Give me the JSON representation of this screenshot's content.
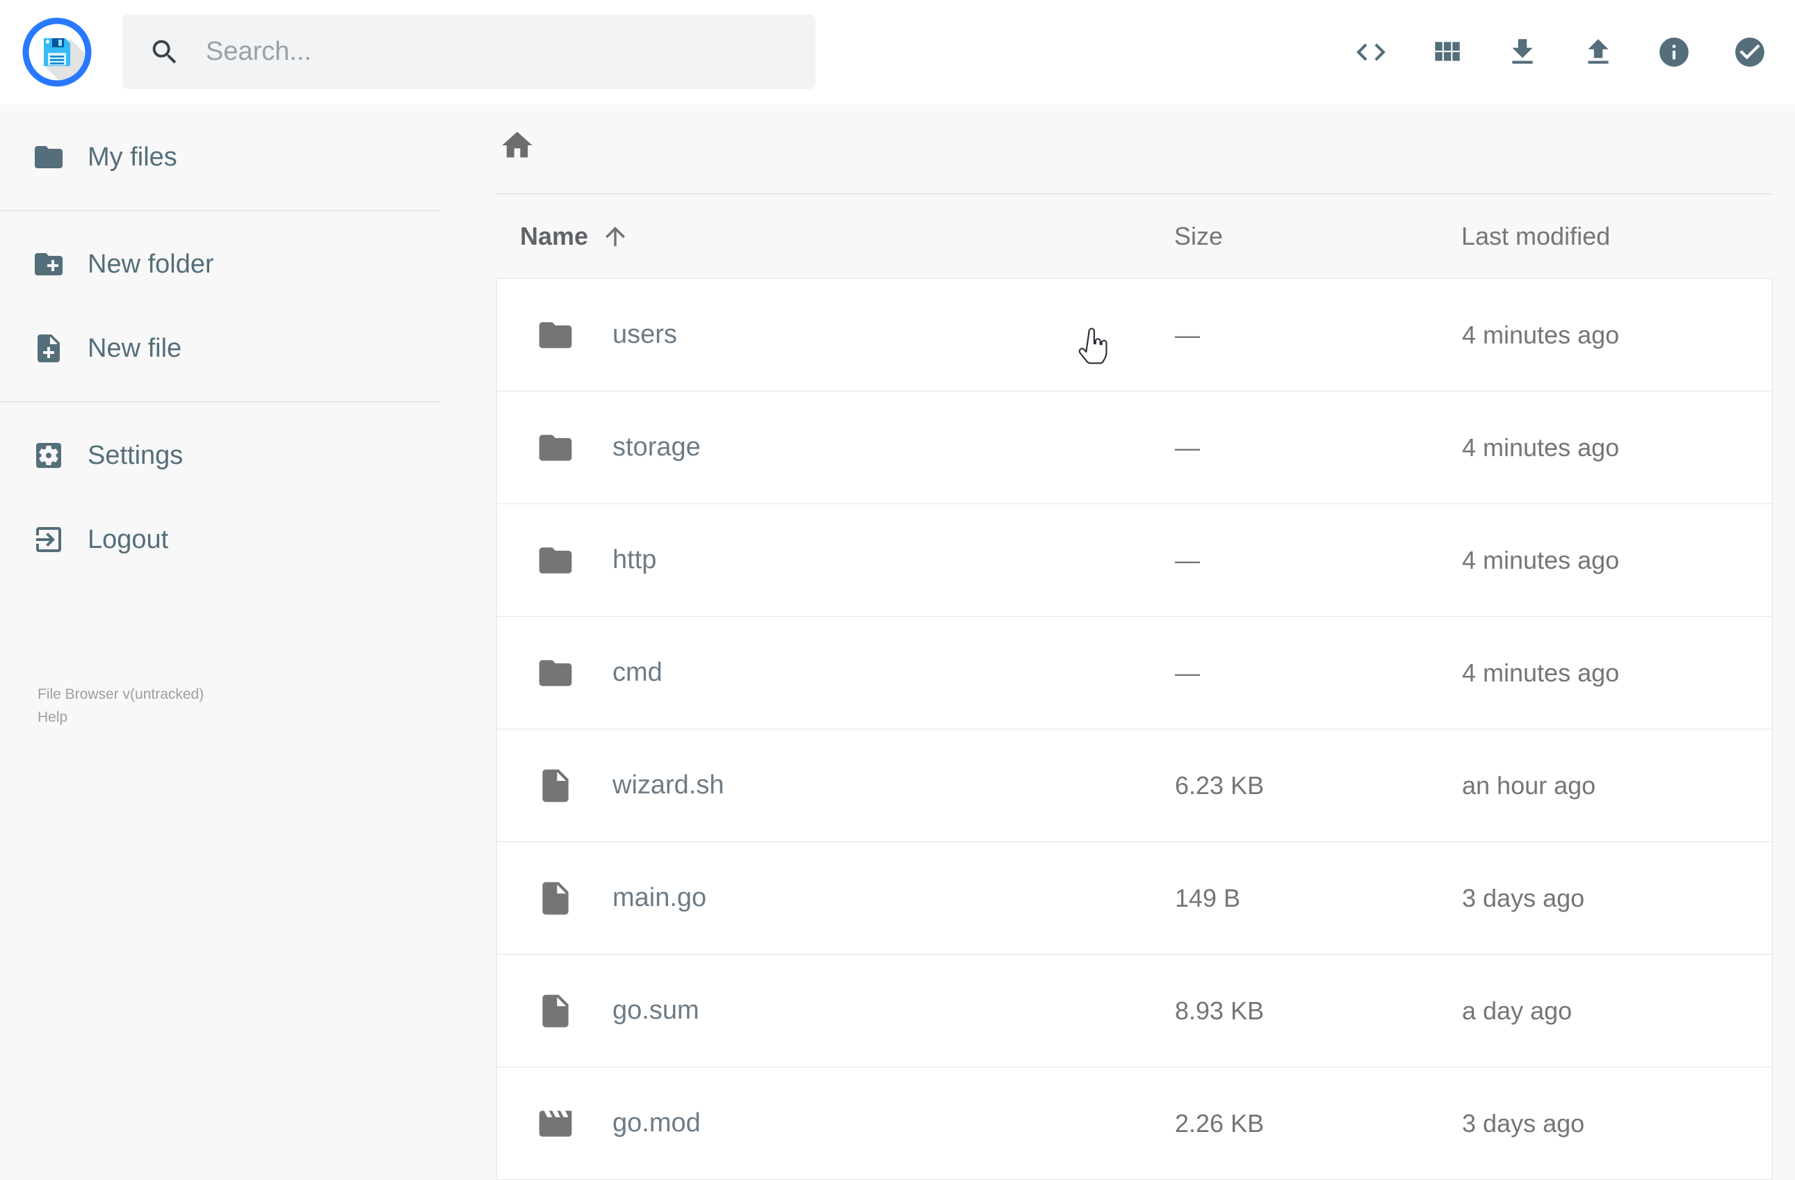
{
  "header": {
    "search": {
      "placeholder": "Search..."
    },
    "actions": [
      {
        "label": "toggle-shell"
      },
      {
        "label": "switch-view"
      },
      {
        "label": "download"
      },
      {
        "label": "upload"
      },
      {
        "label": "info"
      },
      {
        "label": "select-multiple"
      }
    ]
  },
  "sidebar": {
    "items": [
      {
        "label": "My files"
      },
      {
        "label": "New folder"
      },
      {
        "label": "New file"
      },
      {
        "label": "Settings"
      },
      {
        "label": "Logout"
      }
    ],
    "footer": {
      "version": "File Browser v(untracked)",
      "help": "Help"
    }
  },
  "listing": {
    "columns": {
      "name": "Name",
      "size": "Size",
      "modified": "Last modified"
    },
    "sort": {
      "column": "name",
      "direction": "asc"
    },
    "rows": [
      {
        "name": "users",
        "icon": "folder",
        "size": "—",
        "modified": "4 minutes ago"
      },
      {
        "name": "storage",
        "icon": "folder",
        "size": "—",
        "modified": "4 minutes ago"
      },
      {
        "name": "http",
        "icon": "folder",
        "size": "—",
        "modified": "4 minutes ago"
      },
      {
        "name": "cmd",
        "icon": "folder",
        "size": "—",
        "modified": "4 minutes ago"
      },
      {
        "name": "wizard.sh",
        "icon": "file",
        "size": "6.23 KB",
        "modified": "an hour ago"
      },
      {
        "name": "main.go",
        "icon": "file",
        "size": "149 B",
        "modified": "3 days ago"
      },
      {
        "name": "go.sum",
        "icon": "file",
        "size": "8.93 KB",
        "modified": "a day ago"
      },
      {
        "name": "go.mod",
        "icon": "movie",
        "size": "2.26 KB",
        "modified": "3 days ago"
      }
    ]
  },
  "colors": {
    "accent": "#2979ff",
    "slate": "#546e7a",
    "row_border": "#e4e4e4"
  }
}
